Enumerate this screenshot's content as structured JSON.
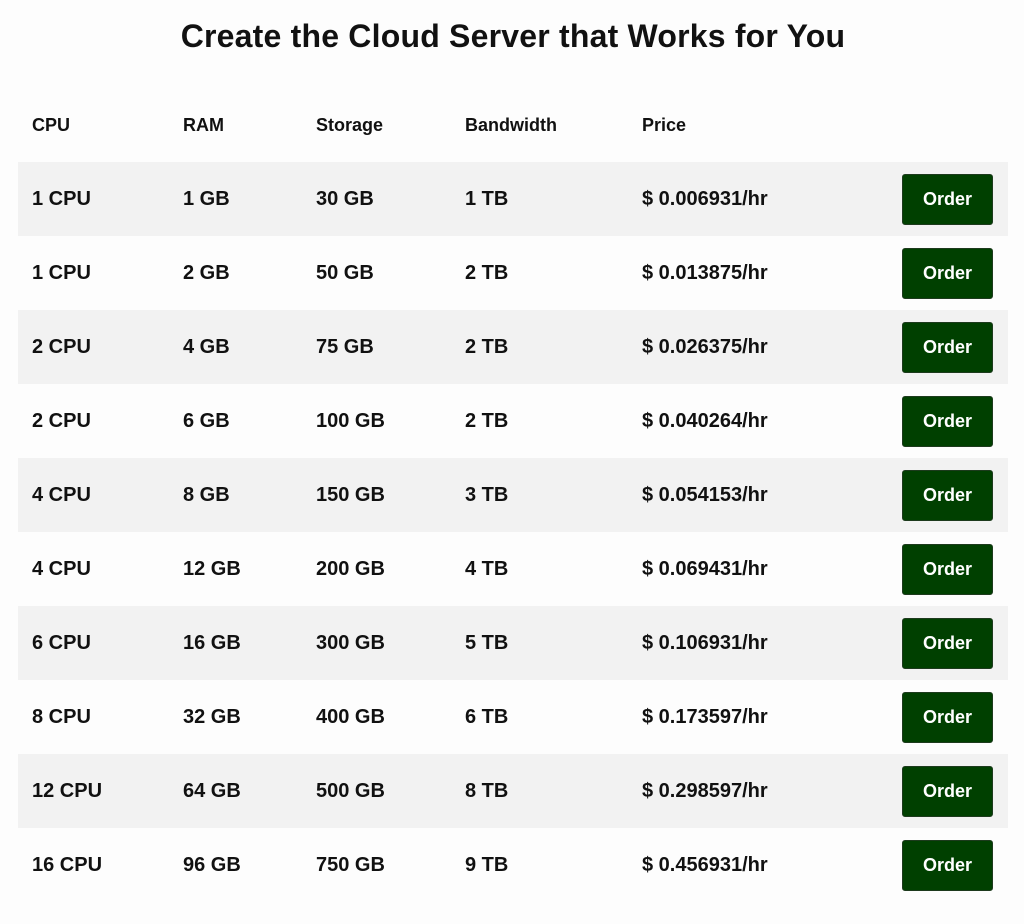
{
  "page": {
    "title": "Create the Cloud Server that Works for You"
  },
  "table": {
    "headers": {
      "cpu": "CPU",
      "ram": "RAM",
      "storage": "Storage",
      "bandwidth": "Bandwidth",
      "price": "Price"
    },
    "rows": [
      {
        "cpu": "1 CPU",
        "ram": "1 GB",
        "storage": "30 GB",
        "bandwidth": "1 TB",
        "price": "$ 0.006931/hr",
        "action": "Order"
      },
      {
        "cpu": "1 CPU",
        "ram": "2 GB",
        "storage": "50 GB",
        "bandwidth": "2 TB",
        "price": "$ 0.013875/hr",
        "action": "Order"
      },
      {
        "cpu": "2 CPU",
        "ram": "4 GB",
        "storage": "75 GB",
        "bandwidth": "2 TB",
        "price": "$ 0.026375/hr",
        "action": "Order"
      },
      {
        "cpu": "2 CPU",
        "ram": "6 GB",
        "storage": "100 GB",
        "bandwidth": "2 TB",
        "price": "$ 0.040264/hr",
        "action": "Order"
      },
      {
        "cpu": "4 CPU",
        "ram": "8 GB",
        "storage": "150 GB",
        "bandwidth": "3 TB",
        "price": "$ 0.054153/hr",
        "action": "Order"
      },
      {
        "cpu": "4 CPU",
        "ram": "12 GB",
        "storage": "200 GB",
        "bandwidth": "4 TB",
        "price": "$ 0.069431/hr",
        "action": "Order"
      },
      {
        "cpu": "6 CPU",
        "ram": "16 GB",
        "storage": "300 GB",
        "bandwidth": "5 TB",
        "price": "$ 0.106931/hr",
        "action": "Order"
      },
      {
        "cpu": "8 CPU",
        "ram": "32 GB",
        "storage": "400 GB",
        "bandwidth": "6 TB",
        "price": "$ 0.173597/hr",
        "action": "Order"
      },
      {
        "cpu": "12 CPU",
        "ram": "64 GB",
        "storage": "500 GB",
        "bandwidth": "8 TB",
        "price": "$ 0.298597/hr",
        "action": "Order"
      },
      {
        "cpu": "16 CPU",
        "ram": "96 GB",
        "storage": "750 GB",
        "bandwidth": "9 TB",
        "price": "$ 0.456931/hr",
        "action": "Order"
      }
    ]
  },
  "colors": {
    "button_bg": "#004000",
    "stripe_bg": "#f2f2f2",
    "page_bg": "#fdfdfd"
  }
}
